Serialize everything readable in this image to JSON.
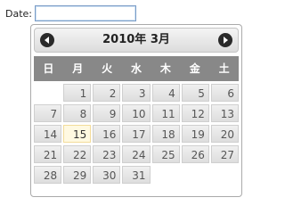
{
  "form": {
    "date_label": "Date:",
    "date_value": "",
    "date_placeholder": ""
  },
  "datepicker": {
    "title": "2010年 3月",
    "weekdays": [
      "日",
      "月",
      "火",
      "水",
      "木",
      "金",
      "土"
    ],
    "first_weekday_offset": 1,
    "days": [
      "1",
      "2",
      "3",
      "4",
      "5",
      "6",
      "7",
      "8",
      "9",
      "10",
      "11",
      "12",
      "13",
      "14",
      "15",
      "16",
      "17",
      "18",
      "19",
      "20",
      "21",
      "22",
      "23",
      "24",
      "25",
      "26",
      "27",
      "28",
      "29",
      "30",
      "31"
    ],
    "today": "15",
    "colors": {
      "header_bar": "#888888",
      "today_bg": "#fff9e1",
      "day_bg": "#e6e6e6",
      "input_border": "#7a9cc6"
    }
  }
}
